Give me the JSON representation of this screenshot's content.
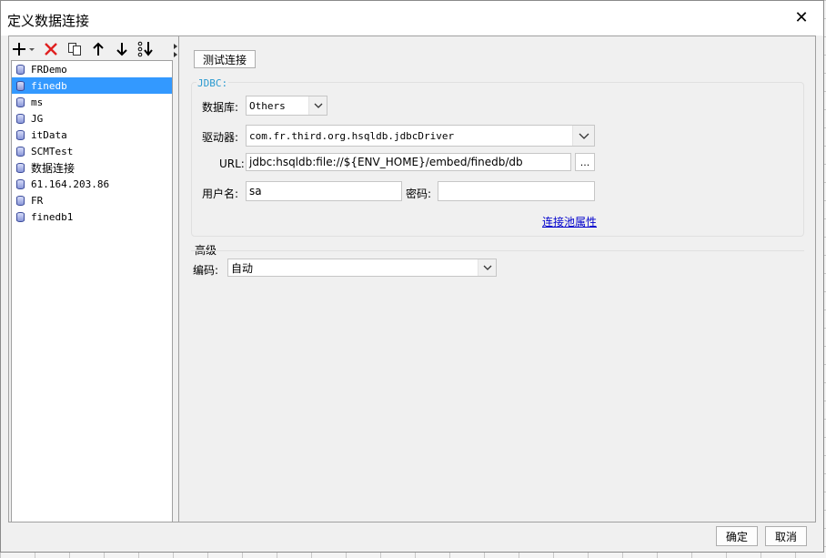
{
  "window": {
    "title": "定义数据连接",
    "close_glyph": "✕"
  },
  "toolbar": {
    "add_icon": "plus-icon",
    "delete_icon": "delete-icon",
    "copy_icon": "copy-icon",
    "up_icon": "arrow-up-icon",
    "down_icon": "arrow-down-icon",
    "sort_icon": "sort-icon"
  },
  "connections": [
    {
      "label": "FRDemo",
      "selected": false
    },
    {
      "label": "finedb",
      "selected": true
    },
    {
      "label": "ms",
      "selected": false
    },
    {
      "label": "JG",
      "selected": false
    },
    {
      "label": "itData",
      "selected": false
    },
    {
      "label": "SCMTest",
      "selected": false
    },
    {
      "label": "数据连接",
      "selected": false
    },
    {
      "label": "61.164.203.86",
      "selected": false
    },
    {
      "label": "FR",
      "selected": false
    },
    {
      "label": "finedb1",
      "selected": false
    }
  ],
  "form": {
    "test_button": "测试连接",
    "group_title": "JDBC:",
    "database_label": "数据库:",
    "database_value": "Others",
    "driver_label": "驱动器:",
    "driver_value": "com.fr.third.org.hsqldb.jdbcDriver",
    "url_label": "URL:",
    "url_value": "jdbc:hsqldb:file://${ENV_HOME}/embed/finedb/db",
    "url_browse": "...",
    "username_label": "用户名:",
    "username_value": "sa",
    "password_label": "密码:",
    "password_value": "",
    "pool_link": "连接池属性",
    "advanced_title": "高级",
    "encoding_label": "编码:",
    "encoding_value": "自动"
  },
  "footer": {
    "ok": "确定",
    "cancel": "取消"
  },
  "colors": {
    "selection": "#3399ff",
    "link": "#0000cc",
    "group_title": "#2a9ad0",
    "delete": "#e02020"
  }
}
